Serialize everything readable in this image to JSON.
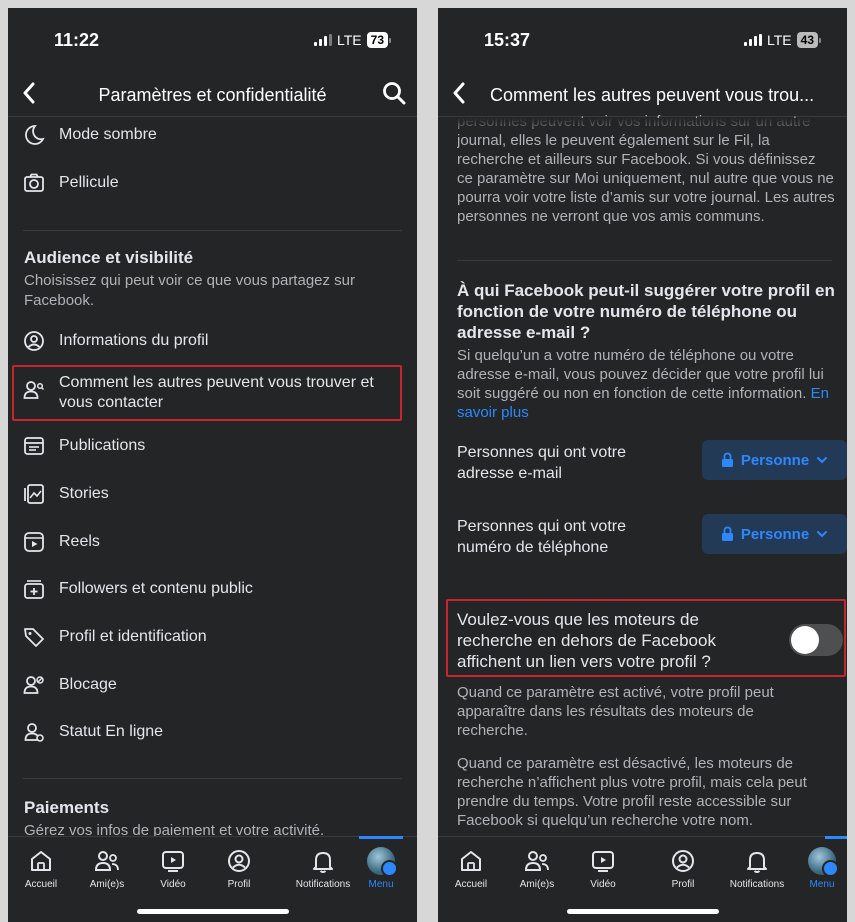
{
  "left": {
    "status": {
      "time": "11:22",
      "network": "LTE",
      "battery": "73"
    },
    "header": {
      "title": "Paramètres et confidentialité"
    },
    "top_items": [
      {
        "label": "Mode sombre",
        "icon": "moon-icon"
      },
      {
        "label": "Pellicule",
        "icon": "camera-icon"
      }
    ],
    "audience": {
      "title": "Audience et visibilité",
      "subtitle": "Choisissez qui peut voir ce que vous partagez sur Facebook.",
      "items": [
        {
          "label": "Informations du profil",
          "icon": "profile-icon"
        },
        {
          "label": "Comment les autres peuvent vous trouver et vous contacter",
          "icon": "find-people-icon"
        },
        {
          "label": "Publications",
          "icon": "posts-icon"
        },
        {
          "label": "Stories",
          "icon": "stories-icon"
        },
        {
          "label": "Reels",
          "icon": "reels-icon"
        },
        {
          "label": "Followers et contenu public",
          "icon": "followers-icon"
        },
        {
          "label": "Profil et identification",
          "icon": "tag-icon"
        },
        {
          "label": "Blocage",
          "icon": "block-icon"
        },
        {
          "label": "Statut En ligne",
          "icon": "online-status-icon"
        }
      ]
    },
    "payments": {
      "title": "Paiements",
      "subtitle": "Gérez vos infos de paiement et votre activité."
    }
  },
  "right": {
    "status": {
      "time": "15:37",
      "network": "LTE",
      "battery": "43"
    },
    "header": {
      "title": "Comment les autres peuvent vous trou..."
    },
    "intro_text": "personnes peuvent voir vos informations sur un autre journal, elles le peuvent également sur le Fil, la recherche et ailleurs sur Facebook. Si vous définissez ce paramètre sur Moi uniquement, nul autre que vous ne pourra voir votre liste d’amis sur votre journal. Les autres personnes ne verront que vos amis communs.",
    "suggest": {
      "title": "À qui Facebook peut-il suggérer votre profil en fonction de votre numéro de téléphone ou adresse e-mail ?",
      "description": "Si quelqu’un a votre numéro de téléphone ou votre adresse e-mail, vous pouvez décider que votre profil lui soit suggéré ou non en fonction de cette information.",
      "link": "En savoir plus",
      "options": [
        {
          "label": "Personnes qui ont votre adresse e-mail",
          "value": "Personne"
        },
        {
          "label": "Personnes qui ont votre numéro de téléphone",
          "value": "Personne"
        }
      ]
    },
    "search_engines": {
      "title": "Voulez-vous que les moteurs de recherche en dehors de Facebook affichent un lien vers votre profil ?",
      "toggle_on": false,
      "desc_on": "Quand ce paramètre est activé, votre profil peut apparaître dans les résultats des moteurs de recherche.",
      "desc_off": "Quand ce paramètre est désactivé, les moteurs de recherche n’affichent plus votre profil, mais cela peut prendre du temps. Votre profil reste accessible sur Facebook si quelqu’un recherche votre nom."
    }
  },
  "tabbar": {
    "tabs": [
      {
        "label": "Accueil",
        "icon": "home-icon"
      },
      {
        "label": "Ami(e)s",
        "icon": "friends-icon"
      },
      {
        "label": "Vidéo",
        "icon": "video-icon"
      },
      {
        "label": "Profil",
        "icon": "profile-icon"
      },
      {
        "label": "Notifications",
        "icon": "bell-icon"
      },
      {
        "label": "Menu",
        "icon": "menu-avatar-icon"
      }
    ],
    "active": "Menu"
  },
  "colors": {
    "background": "#242526",
    "accent": "#2d88ff",
    "highlight": "#c8242b",
    "text": "#e4e6eb",
    "secondary": "#b0b3b8"
  }
}
